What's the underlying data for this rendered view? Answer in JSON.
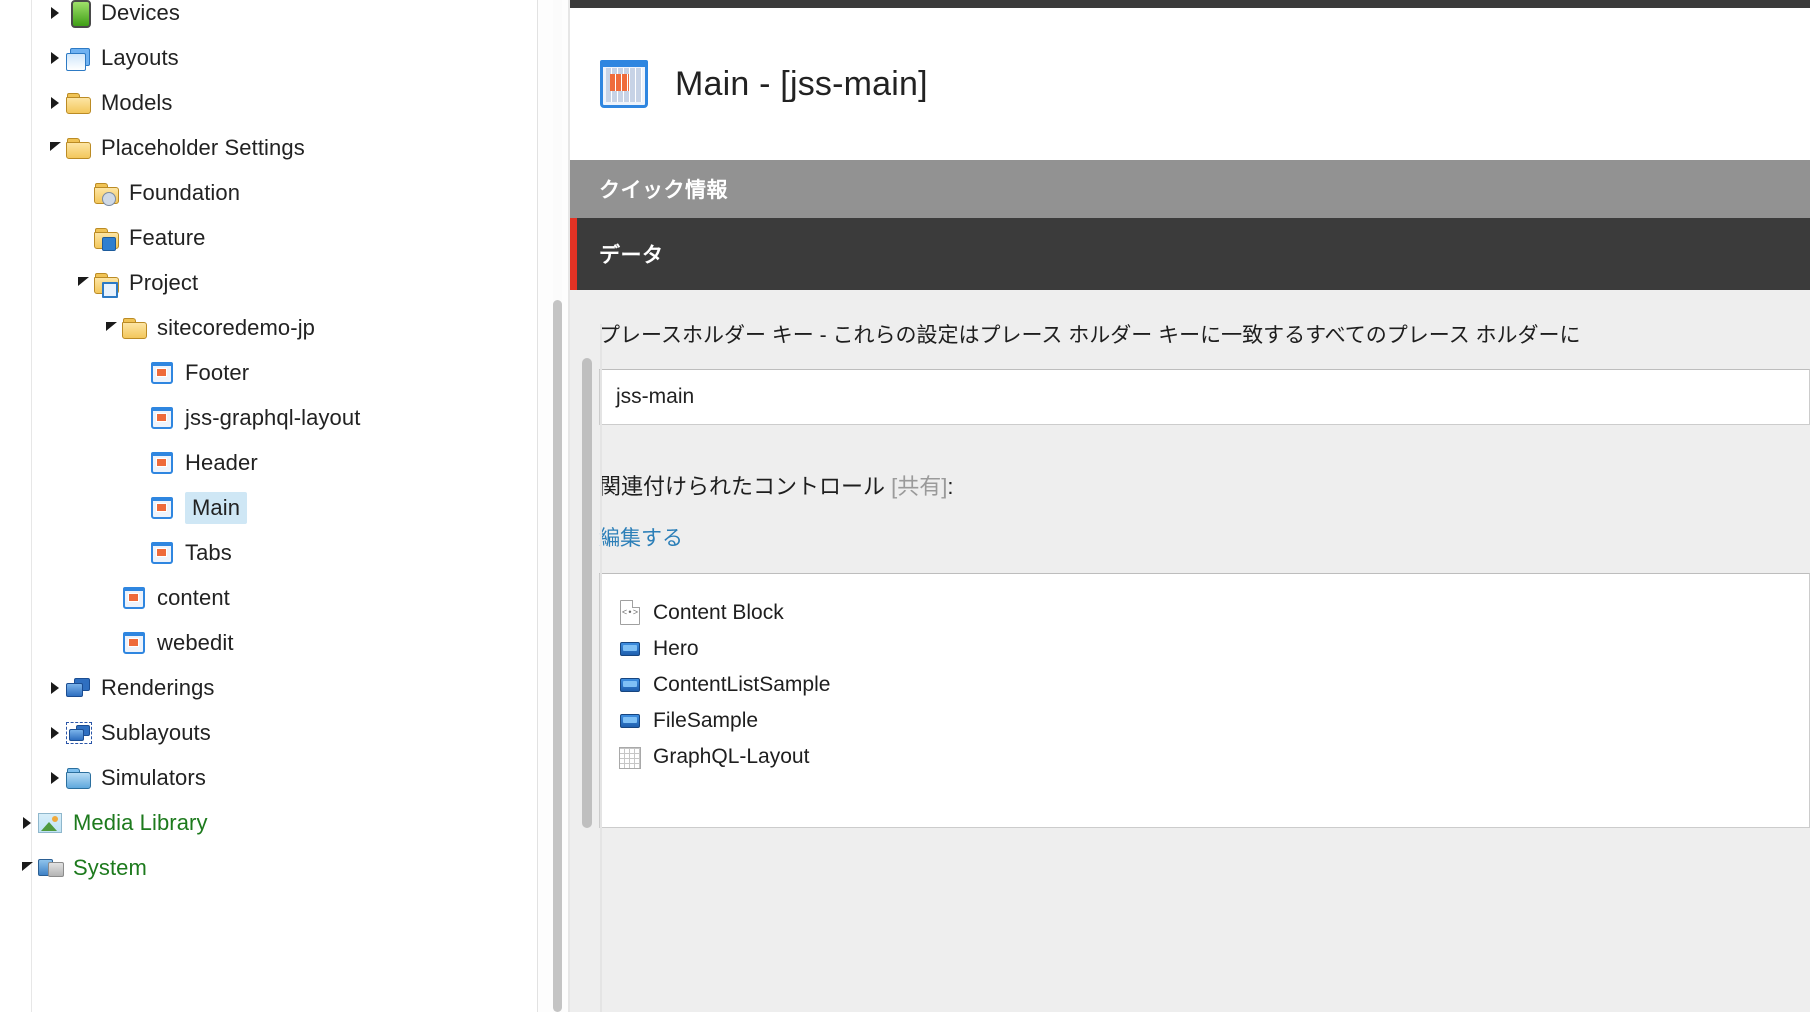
{
  "tree": {
    "items": [
      {
        "label": "Devices",
        "indent": 0,
        "twisty": "collapsed",
        "icon": "device-icon",
        "color": "default",
        "selected": false
      },
      {
        "label": "Layouts",
        "indent": 0,
        "twisty": "collapsed",
        "icon": "layouts-icon",
        "color": "default",
        "selected": false
      },
      {
        "label": "Models",
        "indent": 0,
        "twisty": "collapsed",
        "icon": "folder-icon",
        "color": "default",
        "selected": false
      },
      {
        "label": "Placeholder Settings",
        "indent": 0,
        "twisty": "expanded",
        "icon": "folder-icon",
        "color": "default",
        "selected": false
      },
      {
        "label": "Foundation",
        "indent": 1,
        "twisty": "none",
        "icon": "folder-gear-icon",
        "color": "default",
        "selected": false
      },
      {
        "label": "Feature",
        "indent": 1,
        "twisty": "none",
        "icon": "folder-people-icon",
        "color": "default",
        "selected": false
      },
      {
        "label": "Project",
        "indent": 1,
        "twisty": "expanded",
        "icon": "folder-window-icon",
        "color": "default",
        "selected": false
      },
      {
        "label": "sitecoredemo-jp",
        "indent": 2,
        "twisty": "expanded",
        "icon": "folder-icon",
        "color": "default",
        "selected": false
      },
      {
        "label": "Footer",
        "indent": 3,
        "twisty": "none",
        "icon": "placeholder-icon",
        "color": "default",
        "selected": false
      },
      {
        "label": "jss-graphql-layout",
        "indent": 3,
        "twisty": "none",
        "icon": "placeholder-icon",
        "color": "default",
        "selected": false
      },
      {
        "label": "Header",
        "indent": 3,
        "twisty": "none",
        "icon": "placeholder-icon",
        "color": "default",
        "selected": false
      },
      {
        "label": "Main",
        "indent": 3,
        "twisty": "none",
        "icon": "placeholder-icon",
        "color": "default",
        "selected": true
      },
      {
        "label": "Tabs",
        "indent": 3,
        "twisty": "none",
        "icon": "placeholder-icon",
        "color": "default",
        "selected": false
      },
      {
        "label": "content",
        "indent": 2,
        "twisty": "none",
        "icon": "placeholder-icon",
        "color": "default",
        "selected": false
      },
      {
        "label": "webedit",
        "indent": 2,
        "twisty": "none",
        "icon": "placeholder-icon",
        "color": "default",
        "selected": false
      },
      {
        "label": "Renderings",
        "indent": 0,
        "twisty": "collapsed",
        "icon": "renderings-icon",
        "color": "default",
        "selected": false
      },
      {
        "label": "Sublayouts",
        "indent": 0,
        "twisty": "collapsed",
        "icon": "sublayouts-icon",
        "color": "default",
        "selected": false
      },
      {
        "label": "Simulators",
        "indent": 0,
        "twisty": "collapsed",
        "icon": "folder-blue-icon",
        "color": "default",
        "selected": false
      },
      {
        "label": "Media Library",
        "indent": -1,
        "twisty": "collapsed",
        "icon": "media-library-icon",
        "color": "green",
        "selected": false
      },
      {
        "label": "System",
        "indent": -1,
        "twisty": "expanded",
        "icon": "system-icon",
        "color": "green",
        "selected": false
      }
    ]
  },
  "detail": {
    "item_title": "Main - [jss-main]",
    "item_icon": "placeholder-large-icon",
    "quick_info_label": "クイック情報",
    "data_section_label": "データ",
    "field": {
      "description": "プレースホルダー キー - これらの設定はプレース ホルダー キーに一致するすべてのプレース ホルダーに",
      "value": "jss-main",
      "placeholder": ""
    },
    "associated": {
      "label": "関連付けられたコントロール",
      "shared": "[共有]",
      "colon": ":",
      "edit_link": "編集する",
      "controls": [
        {
          "label": "Content Block",
          "icon": "code-document-icon"
        },
        {
          "label": "Hero",
          "icon": "rendering-blue-icon"
        },
        {
          "label": "ContentListSample",
          "icon": "rendering-blue-icon"
        },
        {
          "label": "FileSample",
          "icon": "rendering-blue-icon"
        },
        {
          "label": "GraphQL-Layout",
          "icon": "grid-layout-icon"
        }
      ]
    }
  },
  "colors": {
    "accent_red": "#e33224",
    "section_gray": "#929292",
    "section_dark": "#3b3b3b",
    "link_blue": "#2c7fb8",
    "selection_blue": "#cfe7f5",
    "green_text": "#1d7a1d"
  }
}
